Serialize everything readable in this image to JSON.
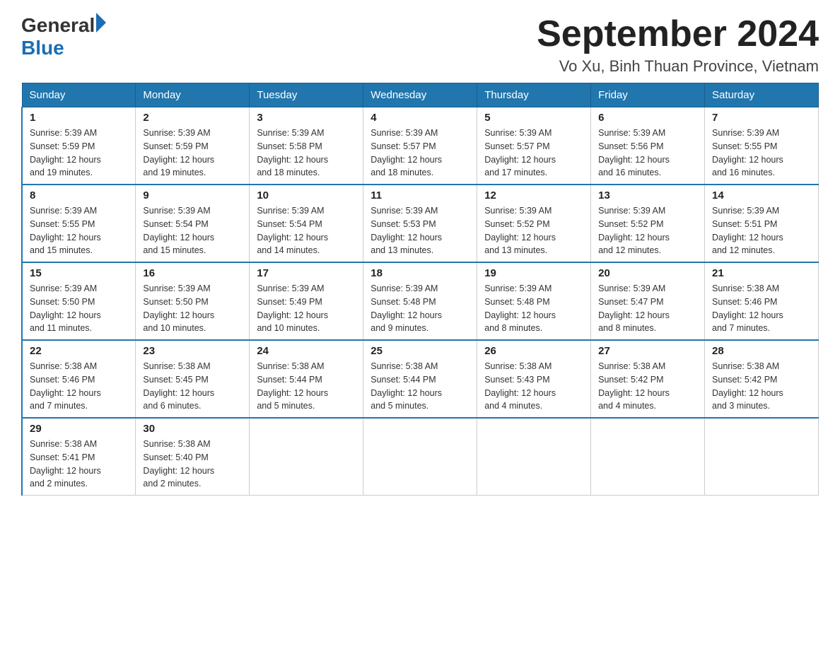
{
  "header": {
    "logo_general": "General",
    "logo_blue": "Blue",
    "title": "September 2024",
    "subtitle": "Vo Xu, Binh Thuan Province, Vietnam"
  },
  "days": [
    "Sunday",
    "Monday",
    "Tuesday",
    "Wednesday",
    "Thursday",
    "Friday",
    "Saturday"
  ],
  "weeks": [
    [
      {
        "day": "1",
        "sunrise": "5:39 AM",
        "sunset": "5:59 PM",
        "daylight": "12 hours and 19 minutes."
      },
      {
        "day": "2",
        "sunrise": "5:39 AM",
        "sunset": "5:59 PM",
        "daylight": "12 hours and 19 minutes."
      },
      {
        "day": "3",
        "sunrise": "5:39 AM",
        "sunset": "5:58 PM",
        "daylight": "12 hours and 18 minutes."
      },
      {
        "day": "4",
        "sunrise": "5:39 AM",
        "sunset": "5:57 PM",
        "daylight": "12 hours and 18 minutes."
      },
      {
        "day": "5",
        "sunrise": "5:39 AM",
        "sunset": "5:57 PM",
        "daylight": "12 hours and 17 minutes."
      },
      {
        "day": "6",
        "sunrise": "5:39 AM",
        "sunset": "5:56 PM",
        "daylight": "12 hours and 16 minutes."
      },
      {
        "day": "7",
        "sunrise": "5:39 AM",
        "sunset": "5:55 PM",
        "daylight": "12 hours and 16 minutes."
      }
    ],
    [
      {
        "day": "8",
        "sunrise": "5:39 AM",
        "sunset": "5:55 PM",
        "daylight": "12 hours and 15 minutes."
      },
      {
        "day": "9",
        "sunrise": "5:39 AM",
        "sunset": "5:54 PM",
        "daylight": "12 hours and 15 minutes."
      },
      {
        "day": "10",
        "sunrise": "5:39 AM",
        "sunset": "5:54 PM",
        "daylight": "12 hours and 14 minutes."
      },
      {
        "day": "11",
        "sunrise": "5:39 AM",
        "sunset": "5:53 PM",
        "daylight": "12 hours and 13 minutes."
      },
      {
        "day": "12",
        "sunrise": "5:39 AM",
        "sunset": "5:52 PM",
        "daylight": "12 hours and 13 minutes."
      },
      {
        "day": "13",
        "sunrise": "5:39 AM",
        "sunset": "5:52 PM",
        "daylight": "12 hours and 12 minutes."
      },
      {
        "day": "14",
        "sunrise": "5:39 AM",
        "sunset": "5:51 PM",
        "daylight": "12 hours and 12 minutes."
      }
    ],
    [
      {
        "day": "15",
        "sunrise": "5:39 AM",
        "sunset": "5:50 PM",
        "daylight": "12 hours and 11 minutes."
      },
      {
        "day": "16",
        "sunrise": "5:39 AM",
        "sunset": "5:50 PM",
        "daylight": "12 hours and 10 minutes."
      },
      {
        "day": "17",
        "sunrise": "5:39 AM",
        "sunset": "5:49 PM",
        "daylight": "12 hours and 10 minutes."
      },
      {
        "day": "18",
        "sunrise": "5:39 AM",
        "sunset": "5:48 PM",
        "daylight": "12 hours and 9 minutes."
      },
      {
        "day": "19",
        "sunrise": "5:39 AM",
        "sunset": "5:48 PM",
        "daylight": "12 hours and 8 minutes."
      },
      {
        "day": "20",
        "sunrise": "5:39 AM",
        "sunset": "5:47 PM",
        "daylight": "12 hours and 8 minutes."
      },
      {
        "day": "21",
        "sunrise": "5:38 AM",
        "sunset": "5:46 PM",
        "daylight": "12 hours and 7 minutes."
      }
    ],
    [
      {
        "day": "22",
        "sunrise": "5:38 AM",
        "sunset": "5:46 PM",
        "daylight": "12 hours and 7 minutes."
      },
      {
        "day": "23",
        "sunrise": "5:38 AM",
        "sunset": "5:45 PM",
        "daylight": "12 hours and 6 minutes."
      },
      {
        "day": "24",
        "sunrise": "5:38 AM",
        "sunset": "5:44 PM",
        "daylight": "12 hours and 5 minutes."
      },
      {
        "day": "25",
        "sunrise": "5:38 AM",
        "sunset": "5:44 PM",
        "daylight": "12 hours and 5 minutes."
      },
      {
        "day": "26",
        "sunrise": "5:38 AM",
        "sunset": "5:43 PM",
        "daylight": "12 hours and 4 minutes."
      },
      {
        "day": "27",
        "sunrise": "5:38 AM",
        "sunset": "5:42 PM",
        "daylight": "12 hours and 4 minutes."
      },
      {
        "day": "28",
        "sunrise": "5:38 AM",
        "sunset": "5:42 PM",
        "daylight": "12 hours and 3 minutes."
      }
    ],
    [
      {
        "day": "29",
        "sunrise": "5:38 AM",
        "sunset": "5:41 PM",
        "daylight": "12 hours and 2 minutes."
      },
      {
        "day": "30",
        "sunrise": "5:38 AM",
        "sunset": "5:40 PM",
        "daylight": "12 hours and 2 minutes."
      },
      null,
      null,
      null,
      null,
      null
    ]
  ],
  "labels": {
    "sunrise": "Sunrise:",
    "sunset": "Sunset:",
    "daylight": "Daylight:"
  }
}
